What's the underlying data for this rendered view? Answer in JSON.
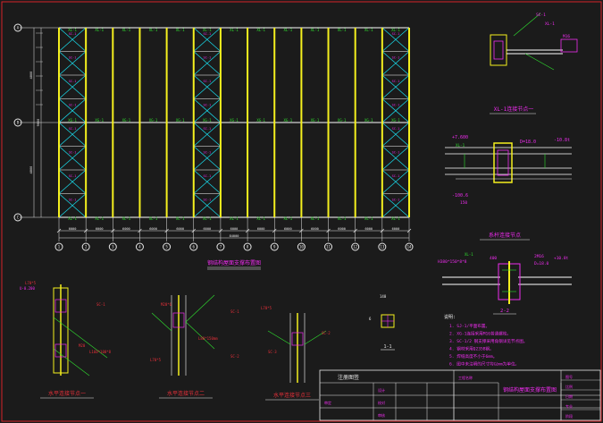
{
  "colors": {
    "background": "#1b1b1b",
    "frame": "#d4232a",
    "column": "#f5f01e",
    "brace": "#19d6e6",
    "beam": "#ffffff",
    "text_red": "#e8303a",
    "text_magenta": "#ee2cee",
    "text_green": "#2fe02f",
    "text_cyan": "#25e0f0",
    "grid_axis": "#e8e8e8"
  },
  "plan": {
    "column_labels": [
      "1",
      "2",
      "3",
      "4",
      "5",
      "6",
      "7",
      "8",
      "9",
      "10",
      "11",
      "12",
      "13",
      "14"
    ],
    "row_labels": [
      "A",
      "B",
      "C"
    ],
    "bay_dims": [
      "6000",
      "6000",
      "6000",
      "6000",
      "6000",
      "6000",
      "6000",
      "6000",
      "6000",
      "6000",
      "6000",
      "6000",
      "6000"
    ],
    "total_dim": "84000",
    "row_dims": [
      "4800",
      "4800"
    ],
    "total_row_dim": "9600",
    "beam_label_top": "XL-1",
    "beam_label_mid": "XG-1",
    "brace_label": "SC-1",
    "caption": "钢结构屋面支撑布置图"
  },
  "details": {
    "node1": {
      "caption": "XL-1连接节点一",
      "labels": [
        "SC-1",
        "XL-1",
        "M16"
      ]
    },
    "section_node": {
      "caption": "系杆连接节点",
      "labels": [
        "+7.600",
        "XL-1",
        "D=18.0",
        "-10.8t",
        "-100.6",
        "150"
      ]
    },
    "section_22": {
      "caption": "2-2",
      "labels": [
        "XL-1",
        "H380*150*8*8",
        "400",
        "2M16",
        "D=18.0",
        "+10.8t"
      ]
    },
    "horiz1": {
      "caption": "水平连接节点一",
      "labels": [
        "L70*5",
        "U-0.200",
        "SC-1",
        "M20",
        "L160*100*8"
      ]
    },
    "horiz2": {
      "caption": "水平连接节点二",
      "labels": [
        "M20*6",
        "SC-1",
        "L80*150mm",
        "L70*5",
        "SC-2"
      ]
    },
    "horiz3": {
      "caption": "水平连接节点三",
      "labels": [
        "L70*5",
        "SC-2",
        "SC-3"
      ]
    },
    "small_1": {
      "caption": "1-1",
      "labels": [
        "140",
        "6"
      ]
    }
  },
  "notes": {
    "title": "说明:",
    "items": [
      "1. SJ-1/平面布置。",
      "2. XG-1连接采用M16普通螺栓。",
      "3. SC-1/2 钢支撑采用角钢详见节点图。",
      "4. 钢材采用Q235B钢。",
      "5. 焊缝高度不小于6mm。",
      "6. 图中未注明的尺寸均以mm为单位。"
    ]
  },
  "title_block": {
    "header": "注册图签",
    "drawing_title": "钢结构屋面支撑布置图",
    "cells": [
      "设计",
      "校对",
      "审核",
      "审定",
      "工程名称",
      "图号",
      "比例",
      "日期",
      "专业",
      "阶段"
    ]
  }
}
